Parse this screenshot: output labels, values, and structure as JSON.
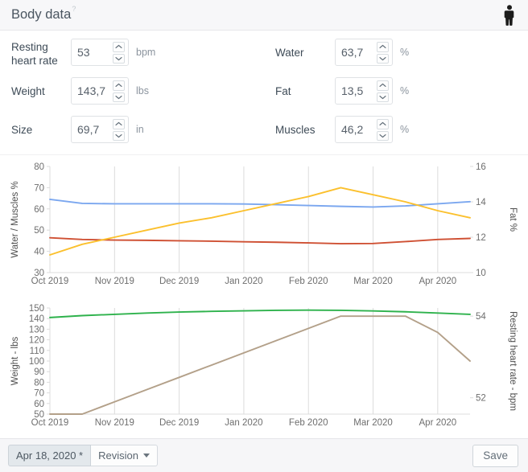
{
  "header": {
    "title": "Body data",
    "help_marker": "?",
    "body_icon": "person-icon"
  },
  "form": {
    "left_fields": [
      {
        "label": "Resting heart rate",
        "value": "53",
        "unit": "bpm",
        "name": "resting-heart-rate",
        "two_line": true
      },
      {
        "label": "Weight",
        "value": "143,7",
        "unit": "lbs",
        "name": "weight",
        "two_line": false
      },
      {
        "label": "Size",
        "value": "69,7",
        "unit": "in",
        "name": "size",
        "two_line": false
      }
    ],
    "right_fields": [
      {
        "label": "Water",
        "value": "63,7",
        "unit": "%",
        "name": "water",
        "two_line": false
      },
      {
        "label": "Fat",
        "value": "13,5",
        "unit": "%",
        "name": "fat",
        "two_line": false
      },
      {
        "label": "Muscles",
        "value": "46,2",
        "unit": "%",
        "name": "muscles",
        "two_line": false
      }
    ]
  },
  "footer": {
    "date_label": "Apr 18, 2020 *",
    "revision_label": "Revision",
    "save_label": "Save"
  },
  "colors": {
    "water_line": "#7ba7ef",
    "muscles_line": "#cf5033",
    "fat_line": "#fbc02d",
    "weight_line": "#2eb24c",
    "heart_rate_line": "#b3a089",
    "grid": "#dcdcdc",
    "axis_text": "#6e6e6e"
  },
  "chart_data": [
    {
      "type": "line",
      "name": "composition-chart",
      "title": "",
      "xlabel": "",
      "ylabel": "Water / Muscles %",
      "y2label": "Fat %",
      "ylim": [
        30,
        80
      ],
      "yticks": [
        30,
        40,
        50,
        60,
        70,
        80
      ],
      "y2lim": [
        10,
        16
      ],
      "y2ticks": [
        10,
        12,
        14,
        16
      ],
      "xticklabels": [
        "Oct 2019",
        "Nov 2019",
        "Dec 2019",
        "Jan 2020",
        "Feb 2020",
        "Mar 2020",
        "Apr 2020"
      ],
      "x": [
        0,
        0.5,
        1,
        1.5,
        2,
        2.5,
        3,
        3.5,
        4,
        4.5,
        5,
        5.5,
        6,
        6.5
      ],
      "grid": true,
      "legend": "none",
      "series": [
        {
          "name": "Water %",
          "axis": "left",
          "color": "#7ba7ef",
          "values": [
            64.5,
            62.6,
            62.4,
            62.4,
            62.4,
            62.4,
            62.3,
            62.0,
            61.6,
            61.2,
            60.9,
            61.4,
            62.4,
            63.4
          ]
        },
        {
          "name": "Muscles %",
          "axis": "left",
          "color": "#cf5033",
          "values": [
            46.4,
            45.6,
            45.3,
            45.2,
            45.0,
            44.8,
            44.5,
            44.3,
            44.0,
            43.6,
            43.7,
            44.6,
            45.6,
            46.1
          ]
        },
        {
          "name": "Fat %",
          "axis": "right",
          "color": "#fbc02d",
          "values": [
            11.0,
            11.6,
            12.0,
            12.4,
            12.8,
            13.1,
            13.5,
            13.9,
            14.3,
            14.8,
            14.4,
            14.0,
            13.5,
            13.1
          ]
        }
      ]
    },
    {
      "type": "line",
      "name": "weight-heart-rate-chart",
      "title": "",
      "xlabel": "",
      "ylabel": "Weight - lbs",
      "y2label": "Resting heart rate - bpm",
      "ylim": [
        50,
        150
      ],
      "yticks": [
        50,
        60,
        70,
        80,
        90,
        100,
        110,
        120,
        130,
        140,
        150
      ],
      "y2lim": [
        51.6,
        54.2
      ],
      "y2ticks": [
        52,
        54
      ],
      "xticklabels": [
        "Oct 2019",
        "Nov 2019",
        "Dec 2019",
        "Jan 2020",
        "Feb 2020",
        "Mar 2020",
        "Apr 2020"
      ],
      "x": [
        0,
        0.5,
        1,
        1.5,
        2,
        2.5,
        3,
        3.5,
        4,
        4.5,
        5,
        5.5,
        6,
        6.5
      ],
      "grid": true,
      "legend": "none",
      "series": [
        {
          "name": "Weight - lbs",
          "axis": "left",
          "color": "#2eb24c",
          "values": [
            141.0,
            142.8,
            144.0,
            145.2,
            146.2,
            146.8,
            147.3,
            147.8,
            148.0,
            147.8,
            147.2,
            146.4,
            145.2,
            144.0
          ]
        },
        {
          "name": "Resting heart rate - bpm",
          "axis": "right",
          "color": "#b3a089",
          "values": [
            51.6,
            51.6,
            51.9,
            52.2,
            52.5,
            52.8,
            53.1,
            53.4,
            53.7,
            54.0,
            54.0,
            54.0,
            53.6,
            52.9
          ]
        }
      ]
    }
  ]
}
